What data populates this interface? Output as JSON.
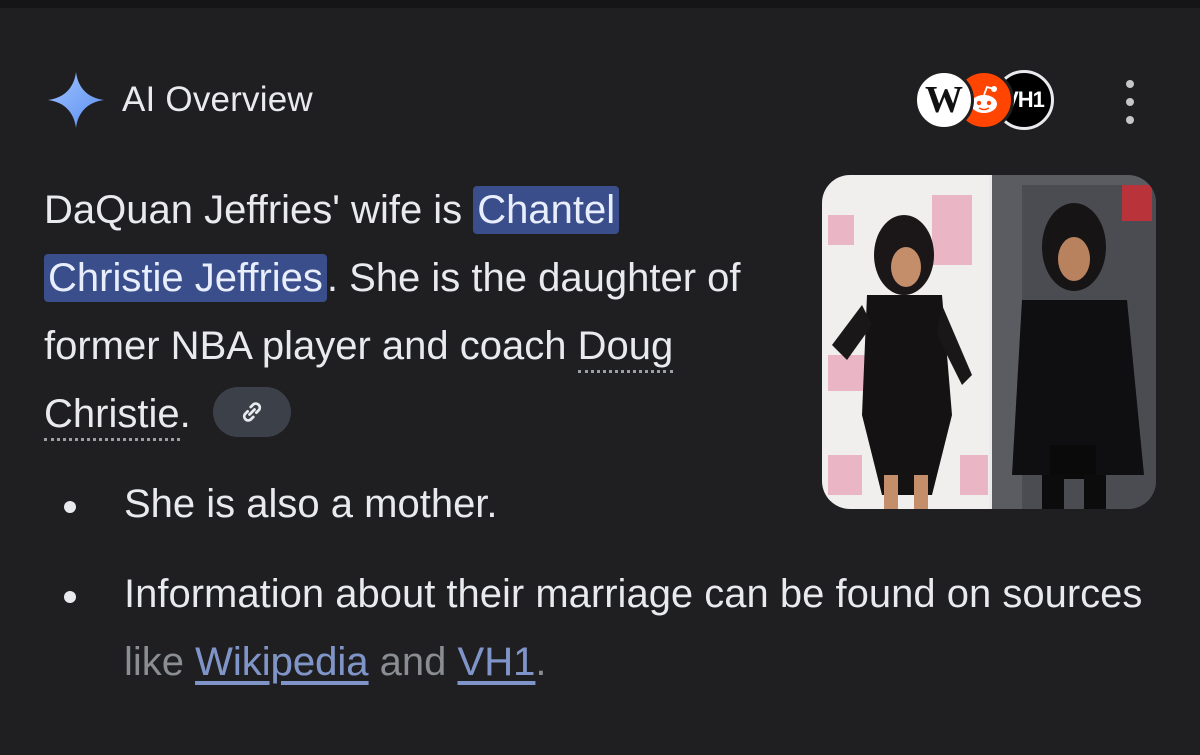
{
  "header": {
    "title": "AI Overview",
    "icon": "sparkle-icon",
    "accent": "#8ab4f8"
  },
  "sources": [
    {
      "name": "wikipedia-source-icon",
      "glyph": "W"
    },
    {
      "name": "reddit-source-icon",
      "glyph": ""
    },
    {
      "name": "vh1-source-icon",
      "glyph": "VH1"
    }
  ],
  "menu_icon": "more-vertical-icon",
  "answer": {
    "prefix": "DaQuan Jeffries' wife is ",
    "highlight_1": "Chantel",
    "highlight_2": "Christie Jeffries",
    "after_highlight": ". She is the daughter of former NBA player and coach ",
    "person_link": "Doug Christie",
    "end": ".",
    "chip_icon": "link-icon"
  },
  "bullets": [
    {
      "text": "She is also a mother."
    },
    {
      "text_before": "Information about their marriage can be found on sources like ",
      "link_1": "Wikipedia",
      "middle": " and ",
      "link_2": "VH1",
      "end": "."
    }
  ],
  "colors": {
    "background": "#1f1f21",
    "highlight": "#3b4e8c",
    "link": "#7f94c9",
    "chip": "#3c4049"
  }
}
